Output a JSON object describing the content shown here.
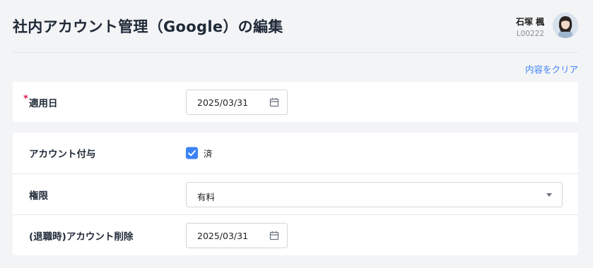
{
  "header": {
    "title": "社内アカウント管理（Google）の編集",
    "user": {
      "name": "石塚 楓",
      "id": "L00222"
    }
  },
  "actions": {
    "clear_label": "内容をクリア"
  },
  "form": {
    "apply_date": {
      "required_mark": "*",
      "label": "適用日",
      "value": "2025/03/31"
    },
    "account_grant": {
      "label": "アカウント付与",
      "checked": true,
      "check_label": "済"
    },
    "permission": {
      "label": "権限",
      "value": "有料"
    },
    "deletion": {
      "label": "(退職時)アカウント削除",
      "value": "2025/03/31"
    }
  },
  "colors": {
    "accent": "#3b82f6",
    "required": "#e11d48",
    "background": "#f3f4f6"
  }
}
